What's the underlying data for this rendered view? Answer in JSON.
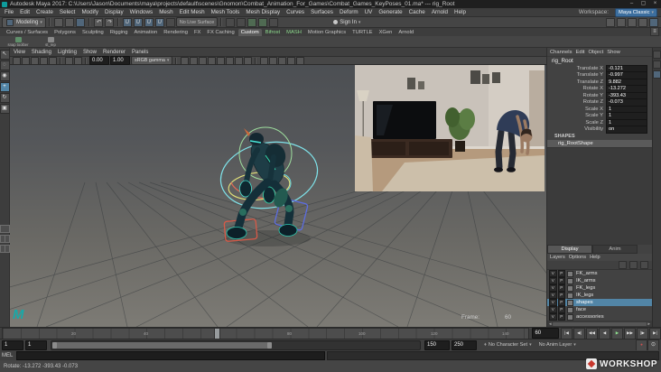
{
  "window": {
    "title": "Autodesk Maya 2017: C:\\Users\\Jason\\Documents\\maya\\projects\\default\\scenes\\Gnomon\\Combat_Animation_For_Games\\Combat_Games_KeyPoses_01.ma* --- rig_Root",
    "minimize": "–",
    "maximize": "▢",
    "close": "×"
  },
  "menu_bar": {
    "items": [
      "File",
      "Edit",
      "Create",
      "Select",
      "Modify",
      "Display",
      "Windows",
      "Mesh",
      "Edit Mesh",
      "Mesh Tools",
      "Mesh Display",
      "Curves",
      "Surfaces",
      "Deform",
      "UV",
      "Generate",
      "Cache",
      "Arnold",
      "Help"
    ],
    "workspace_label": "Workspace:",
    "workspace_value": "Maya Classic"
  },
  "status_line": {
    "menuset": "Modeling",
    "no_live_surface": "No Live Surface",
    "sign_in": "Sign In"
  },
  "shelf": {
    "tabs": [
      "Curves / Surfaces",
      "Polygons",
      "Sculpting",
      "Rigging",
      "Animation",
      "Rendering",
      "FX",
      "FX Caching",
      "Custom",
      "Bifrost",
      "MASH",
      "Motion Graphics",
      "TURTLE",
      "XGen",
      "Arnold"
    ],
    "items": [
      "snap toolber",
      "st_rep"
    ]
  },
  "toolbox": {
    "select": "↖",
    "lasso": "◌",
    "paint": "◉",
    "move": "+",
    "rotate": "↻",
    "scale": "▣"
  },
  "viewport": {
    "menus": [
      "View",
      "Shading",
      "Lighting",
      "Show",
      "Renderer",
      "Panels"
    ],
    "exposure": "0.00",
    "gamma": "1.00",
    "view_transform": "sRGB gamma",
    "frame_label": "Frame:",
    "frame_value": "60"
  },
  "channel_box": {
    "menus": [
      "Channels",
      "Edit",
      "Object",
      "Show"
    ],
    "node": "rig_Root",
    "attributes": [
      {
        "name": "Translate X",
        "value": "-0.121"
      },
      {
        "name": "Translate Y",
        "value": "-0.997"
      },
      {
        "name": "Translate Z",
        "value": "9.882"
      },
      {
        "name": "Rotate X",
        "value": "-13.272"
      },
      {
        "name": "Rotate Y",
        "value": "-393.43"
      },
      {
        "name": "Rotate Z",
        "value": "-0.073"
      },
      {
        "name": "Scale X",
        "value": "1"
      },
      {
        "name": "Scale Y",
        "value": "1"
      },
      {
        "name": "Scale Z",
        "value": "1"
      },
      {
        "name": "Visibility",
        "value": "on"
      }
    ],
    "shapes_heading": "SHAPES",
    "shape_node": "rig_RootShape"
  },
  "layer_editor": {
    "tabs": [
      "Display",
      "Anim"
    ],
    "menus": [
      "Layers",
      "Options",
      "Help"
    ],
    "layers": [
      {
        "v": "V",
        "p": "P",
        "name": "FK_arms"
      },
      {
        "v": "V",
        "p": "P",
        "name": "IK_arms"
      },
      {
        "v": "V",
        "p": "P",
        "name": "FK_legs"
      },
      {
        "v": "V",
        "p": "P",
        "name": "IK_legs"
      },
      {
        "v": "V",
        "p": "P",
        "name": "shapes"
      },
      {
        "v": "V",
        "p": "P",
        "name": "face"
      },
      {
        "v": "V",
        "p": "P",
        "name": "accessories"
      }
    ]
  },
  "time_slider": {
    "tick_labels": [
      "20",
      "40",
      "60",
      "80",
      "100",
      "120",
      "140"
    ]
  },
  "playback": {
    "current_time": "60",
    "buttons": [
      {
        "name": "go-to-start",
        "glyph": "|◀"
      },
      {
        "name": "step-back-frame",
        "glyph": "◀|"
      },
      {
        "name": "step-back-key",
        "glyph": "◀◀"
      },
      {
        "name": "play-backwards",
        "glyph": "◀"
      },
      {
        "name": "play-forwards",
        "glyph": "▶"
      },
      {
        "name": "step-forward-key",
        "glyph": "▶▶"
      },
      {
        "name": "step-forward-frame",
        "glyph": "|▶"
      },
      {
        "name": "go-to-end",
        "glyph": "▶|"
      }
    ]
  },
  "range_slider": {
    "playback_start": "1",
    "anim_start": "1",
    "playback_end": "150",
    "anim_end": "250",
    "character_set": "No Character Set",
    "anim_layer": "No Anim Layer"
  },
  "command_line": {
    "label": "MEL",
    "result": ""
  },
  "help_line": {
    "text": "Rotate: -13.272  -393.43  -0.073"
  },
  "watermark": {
    "text": "WORKSHOP"
  },
  "icons": {
    "caret": "▾",
    "undo": "↶",
    "redo": "↷",
    "magnet": "U",
    "key": "♦",
    "autokey_dot": "●",
    "prefs": "⊙",
    "menu": "≡",
    "scroll_left": "◄",
    "scroll_right": "►"
  }
}
